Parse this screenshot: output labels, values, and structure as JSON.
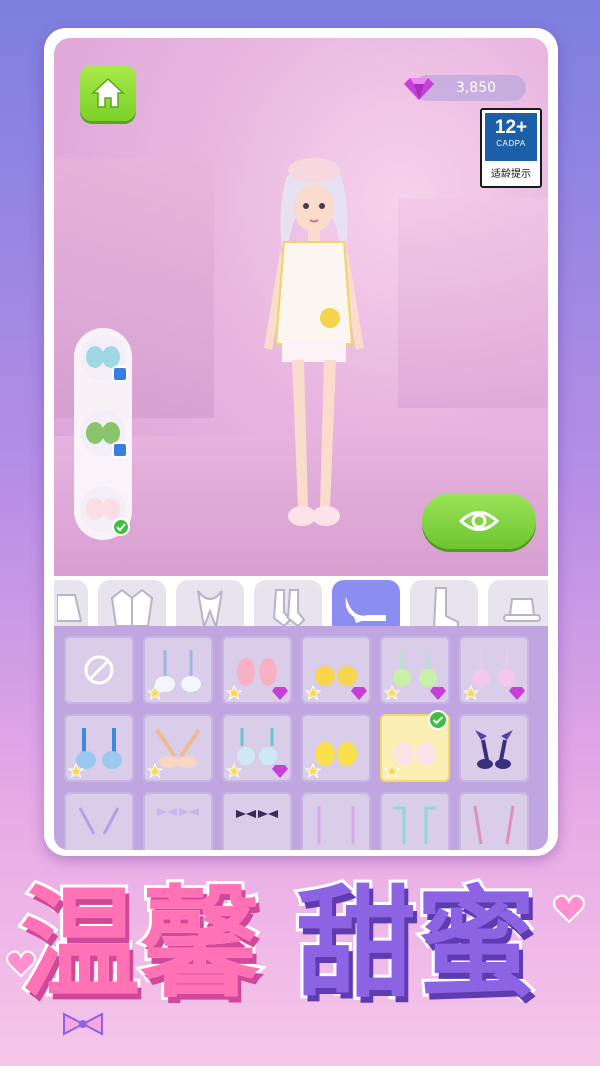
{
  "currency": {
    "gems": "3,850"
  },
  "age_rating": {
    "label": "12+",
    "org": "CADPA",
    "tip": "适龄提示"
  },
  "title": {
    "part1": "温馨",
    "part2": "甜蜜"
  },
  "categories": [
    {
      "name": "skirt-icon",
      "active": false
    },
    {
      "name": "jacket-icon",
      "active": false
    },
    {
      "name": "scarf-icon",
      "active": false
    },
    {
      "name": "socks-icon",
      "active": false
    },
    {
      "name": "heels-icon",
      "active": true
    },
    {
      "name": "boots-icon",
      "active": false
    },
    {
      "name": "hat-icon",
      "active": false
    }
  ],
  "side_items": [
    {
      "name": "slippers-teal-icon",
      "badge": "blue-tag-icon"
    },
    {
      "name": "slippers-green-icon",
      "badge": "blue-tag-icon"
    },
    {
      "name": "slippers-pink-icon",
      "badge": "check-icon"
    }
  ],
  "items_row1": [
    {
      "type": "none"
    },
    {
      "type": "cat-slippers",
      "star": true,
      "gem": false
    },
    {
      "type": "bunny-slippers",
      "star": true,
      "gem": true
    },
    {
      "type": "duck-slippers",
      "star": true,
      "gem": true
    },
    {
      "type": "green-puff",
      "star": true,
      "gem": true
    },
    {
      "type": "pink-puff",
      "star": true,
      "gem": true
    }
  ],
  "items_row2": [
    {
      "type": "blue-fur",
      "star": true,
      "gem": false
    },
    {
      "type": "ribbon-heels",
      "star": true,
      "gem": false
    },
    {
      "type": "pom-heels",
      "star": true,
      "gem": true
    },
    {
      "type": "chick-slippers",
      "star": true,
      "gem": false
    },
    {
      "type": "bunny-pink-slippers",
      "star": true,
      "gem": false,
      "selected": true
    },
    {
      "type": "gothic-heels",
      "star": false,
      "gem": false
    }
  ],
  "colors": {
    "accent": "#8c8df0",
    "green": "#7cd02a",
    "pink": "#ff72b6",
    "purple": "#8c63e3"
  }
}
